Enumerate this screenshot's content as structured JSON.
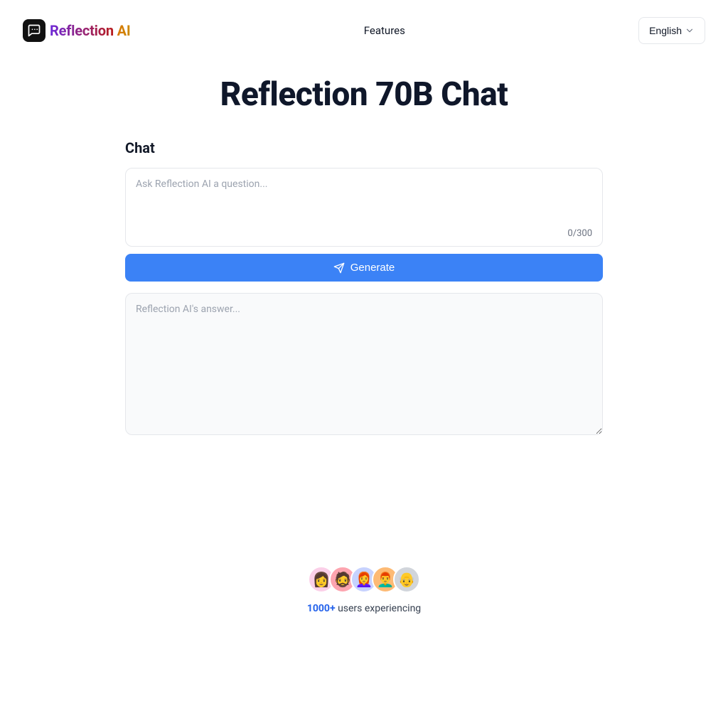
{
  "header": {
    "brand_word1": "Reflection",
    "brand_word2": "AI",
    "nav_features": "Features",
    "lang_label": "English"
  },
  "main": {
    "page_title": "Reflection 70B Chat",
    "section_title": "Chat",
    "input_placeholder": "Ask Reflection AI a question...",
    "char_counter": "0/300",
    "generate_label": "Generate",
    "answer_placeholder": "Reflection AI's answer..."
  },
  "social": {
    "count": "1000+",
    "text": " users experiencing",
    "avatar_colors": [
      "#fbcfe8",
      "#fda4af",
      "#c7d2fe",
      "#fdba74",
      "#d1d5db"
    ],
    "avatar_emoji": [
      "👩",
      "🧔",
      "👩‍🦰",
      "👨‍🦰",
      "👴"
    ]
  }
}
